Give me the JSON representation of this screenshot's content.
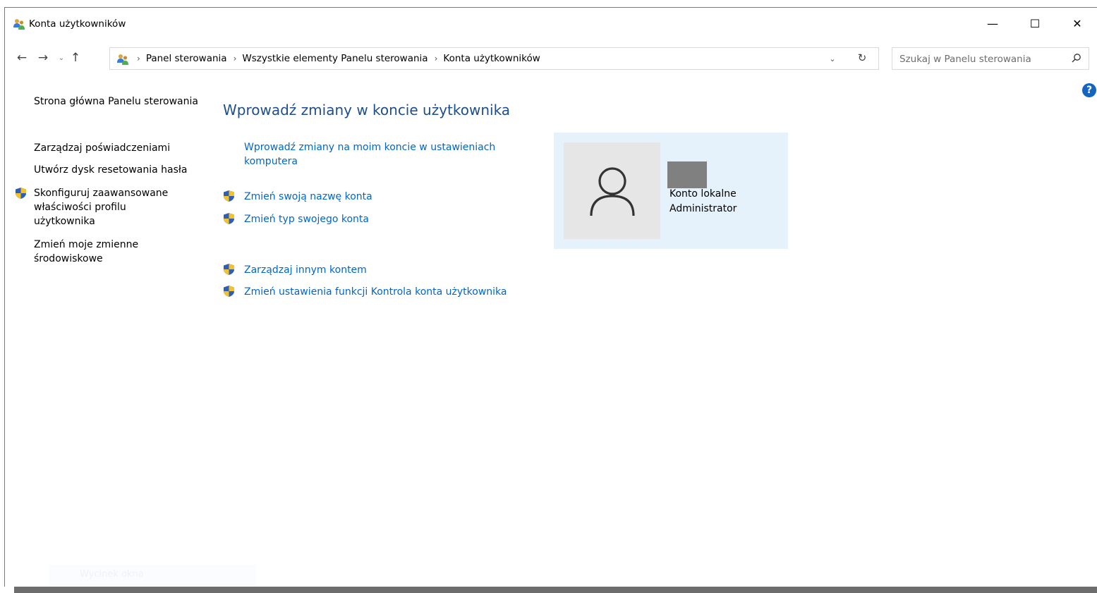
{
  "window": {
    "title": "Konta użytkowników",
    "controls": {
      "minimize": "—",
      "maximize": "☐",
      "close": "✕"
    }
  },
  "address": {
    "crumbs": [
      "Panel sterowania",
      "Wszystkie elementy Panelu sterowania",
      "Konta użytkowników"
    ],
    "separator": "›"
  },
  "search": {
    "placeholder": "Szukaj w Panelu sterowania"
  },
  "sidebar": {
    "items": [
      {
        "label": "Strona główna Panelu sterowania",
        "shield": false
      },
      {
        "label": "Zarządzaj poświadczeniami",
        "shield": false
      },
      {
        "label": "Utwórz dysk resetowania hasła",
        "shield": false
      },
      {
        "label": "Skonfiguruj zaawansowane właściwości profilu użytkownika",
        "shield": true
      },
      {
        "label": "Zmień moje zmienne środowiskowe",
        "shield": false
      }
    ]
  },
  "main": {
    "title": "Wprowadź zmiany w koncie użytkownika",
    "links": [
      {
        "label": "Wprowadź zmiany na moim koncie w ustawieniach komputera",
        "shield": false
      },
      {
        "label": "Zmień swoją nazwę konta",
        "shield": true
      },
      {
        "label": "Zmień typ swojego konta",
        "shield": true
      },
      {
        "label": "Zarządzaj innym kontem",
        "shield": true
      },
      {
        "label": "Zmień ustawienia funkcji Kontrola konta użytkownika",
        "shield": true
      }
    ]
  },
  "account": {
    "type": "Konto lokalne",
    "role": "Administrator"
  },
  "background": {
    "ghost_text": "Wycinek okna"
  },
  "colors": {
    "link": "#0066cc",
    "title": "#1e4e8c",
    "panel": "#e5f1fb",
    "help": "#1565c0"
  }
}
